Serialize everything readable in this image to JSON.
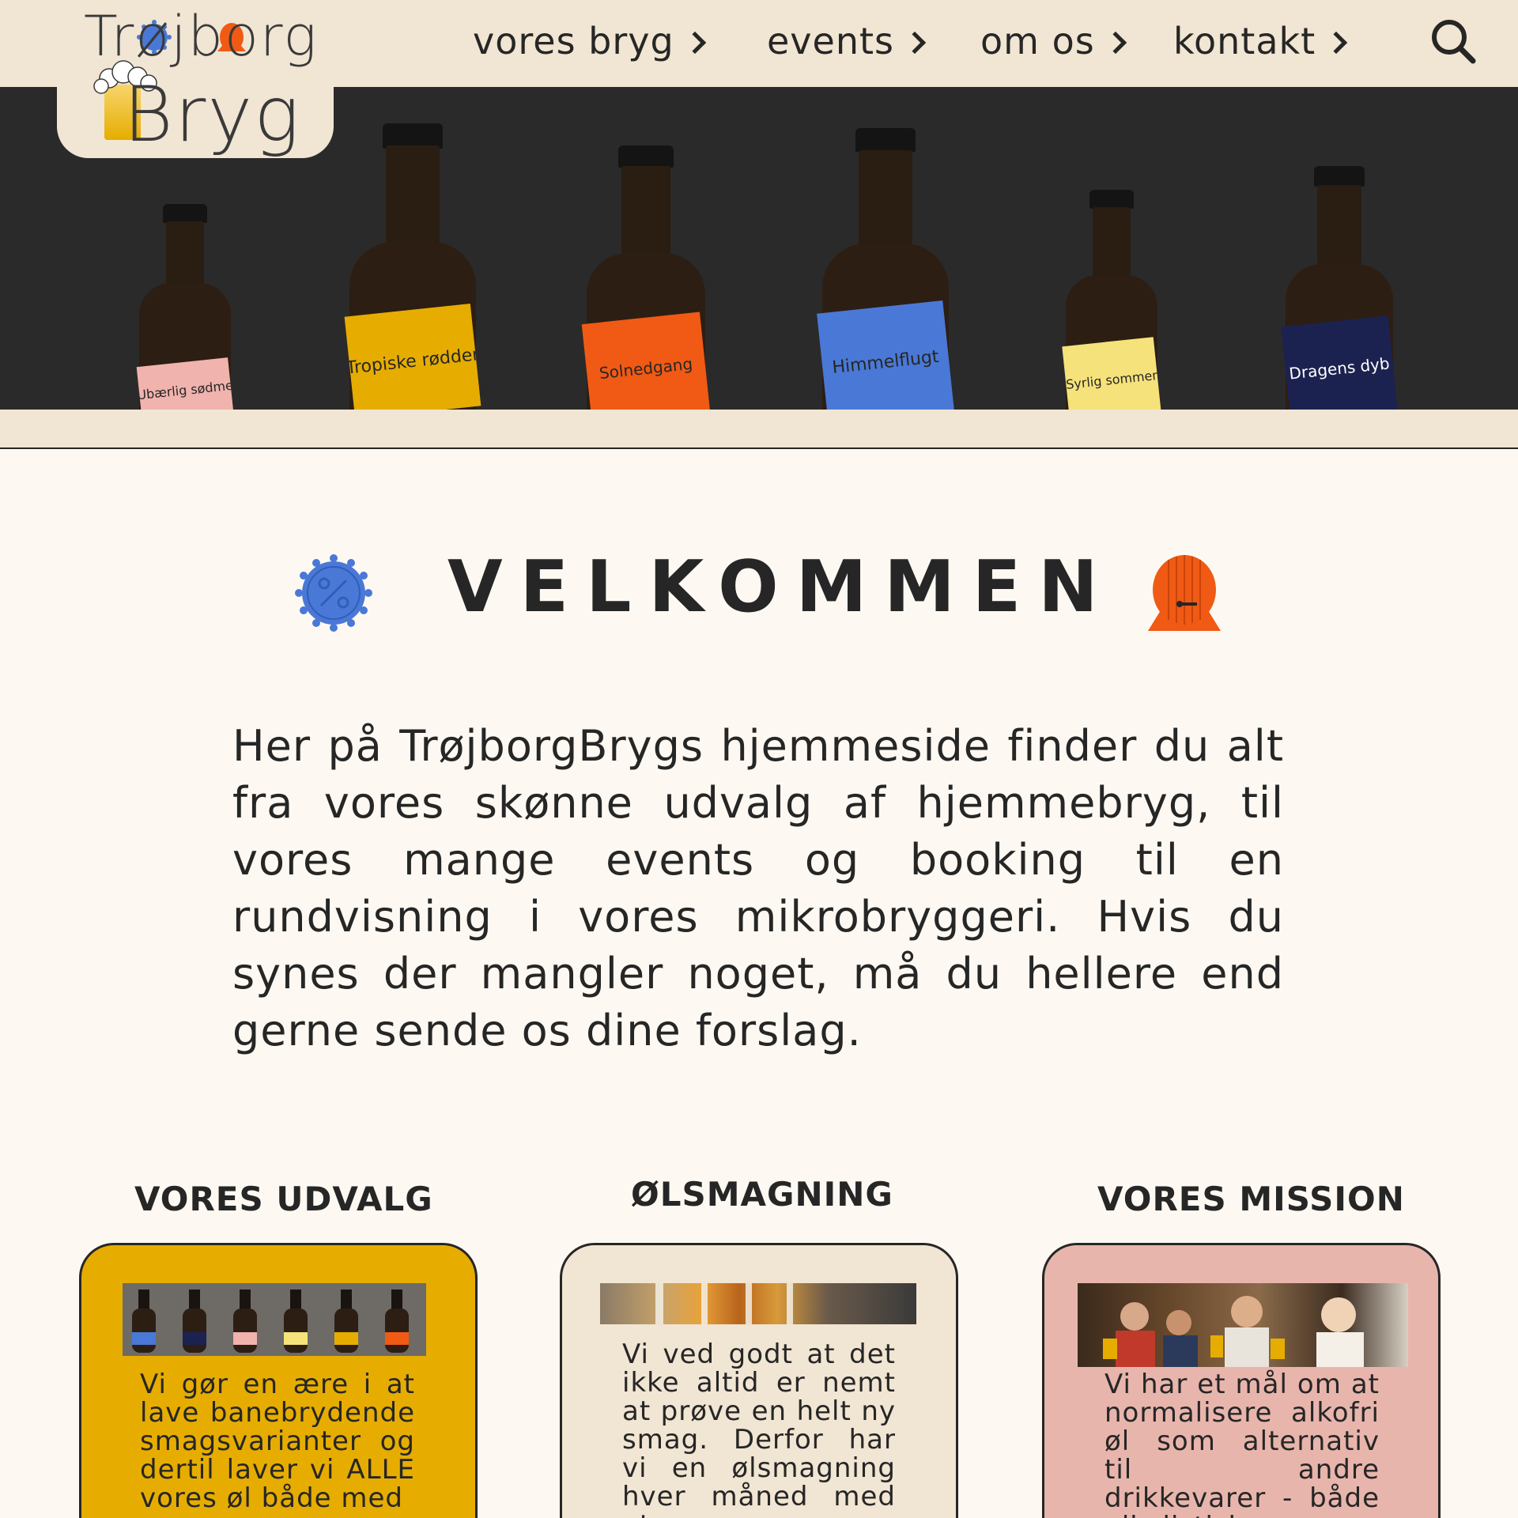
{
  "nav": {
    "items": [
      {
        "label": "vores bryg"
      },
      {
        "label": "events"
      },
      {
        "label": "om os"
      },
      {
        "label": "kontakt"
      }
    ],
    "search_icon": "search-icon"
  },
  "logo": {
    "line1": "Trøjborg",
    "line2": "Bryg"
  },
  "hero": {
    "bottles": [
      {
        "label": "Ubærlig sødme",
        "color": "#f0b3ad"
      },
      {
        "label": "Tropiske rødder",
        "color": "#e6ad00"
      },
      {
        "label": "Solnedgang",
        "color": "#f05a14"
      },
      {
        "label": "Himmelflugt",
        "color": "#4a78d6"
      },
      {
        "label": "Syrlig sommer",
        "color": "#f6e27a"
      },
      {
        "label": "Dragens dyb",
        "color": "#1c2250"
      }
    ]
  },
  "welcome": {
    "title": "VELKOMMEN",
    "intro": "Her på TrøjborgBrygs hjemmeside finder du alt fra vores skønne udvalg af hjemmebryg, til vores mange events og booking til en rundvisning i vores mikrobryggeri. Hvis du synes der mangler noget, må du hellere end gerne sende os dine forslag."
  },
  "cards": [
    {
      "title": "VORES UDVALG",
      "text": "Vi gør en ære i at lave banebrydende smagsvarianter og dertil laver vi ALLE vores øl både med",
      "color": "#e6ad00"
    },
    {
      "title": "ØLSMAGNING",
      "text": "Vi ved godt at det ikke altid er nemt at prøve en helt ny smag. Derfor har vi en ølsmagning hver måned med et",
      "color": "#f1e5d3"
    },
    {
      "title": "VORES MISSION",
      "text": "Vi har et mål om at normalisere alkofri øl som alternativ til andre drikkevarer - både alkolistiske",
      "color": "#e8b5ac"
    }
  ],
  "colors": {
    "nav_bg": "#f1e5d3",
    "page_bg": "#fdf9f2",
    "hero_bg": "#2a2a2a",
    "cap_blue": "#4a78d6",
    "barrel_orange": "#f05a14"
  }
}
